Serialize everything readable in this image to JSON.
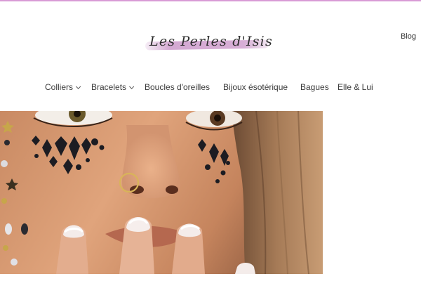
{
  "header": {
    "logo_text": "Les Perles d'Isis",
    "blog_label": "Blog",
    "accent_color": "#d99bd6"
  },
  "nav": {
    "items": [
      {
        "label": "Colliers",
        "has_dropdown": true
      },
      {
        "label": "Bracelets",
        "has_dropdown": true
      },
      {
        "label": "Boucles d'oreilles",
        "has_dropdown": false
      },
      {
        "label": "Bijoux ésotérique",
        "has_dropdown": false
      },
      {
        "label": "Bagues",
        "has_dropdown": false
      },
      {
        "label": "Elle & Lui",
        "has_dropdown": false
      }
    ],
    "dropdown_icon": "chevron-down-icon"
  },
  "hero": {
    "image": "face-with-gem-stickers-nose-ring-french-manicure"
  }
}
